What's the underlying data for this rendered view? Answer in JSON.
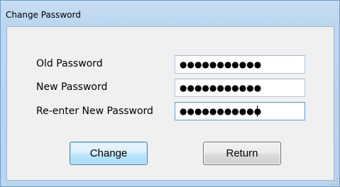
{
  "window": {
    "title": "Change Password"
  },
  "form": {
    "old_password_label": "Old Password",
    "old_password_value": "●●●●●●●●●●●",
    "new_password_label": "New Password",
    "new_password_value": "●●●●●●●●●●●",
    "reenter_label": "Re-enter New Password",
    "reenter_value": "●●●●●●●●●●●"
  },
  "buttons": {
    "change_label": "Change",
    "return_label": "Return"
  }
}
